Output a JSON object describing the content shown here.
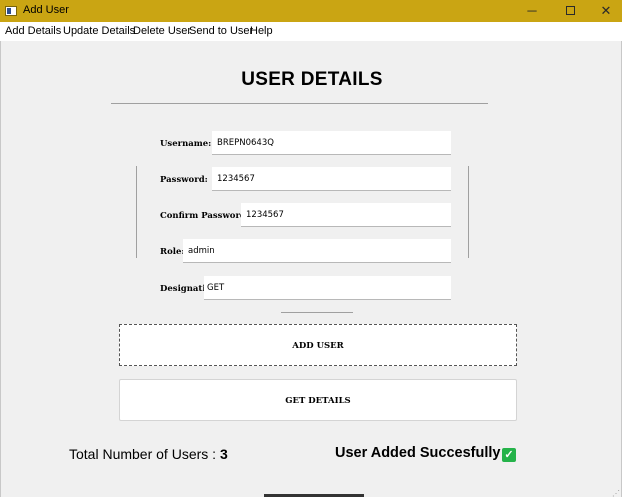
{
  "window": {
    "title": "Add User",
    "controls": {
      "minimize": "─",
      "close": "✕"
    }
  },
  "menu": [
    "Add Details",
    "Update Details",
    "Delete User",
    "Send to User",
    "Help"
  ],
  "page": {
    "heading": "USER DETAILS"
  },
  "form": {
    "username": {
      "label": "Username:",
      "value": "BREPN0643Q"
    },
    "password": {
      "label": "Password:",
      "value": "1234567"
    },
    "confirm_password": {
      "label": "Confirm Password:",
      "value": "1234567"
    },
    "role": {
      "label": "Role:",
      "value": "admin"
    },
    "designation": {
      "label": "Designation:",
      "value": "GET"
    }
  },
  "buttons": {
    "add_user": "ADD USER",
    "get_details": "GET DETAILS"
  },
  "footer": {
    "total_label": "Total Number of Users : ",
    "total_count": "3",
    "status": "User Added Succesfully",
    "status_icon": "check-icon",
    "status_icon_glyph": "✓",
    "status_color": "#25b34a"
  },
  "colors": {
    "titlebar": "#caa513"
  }
}
